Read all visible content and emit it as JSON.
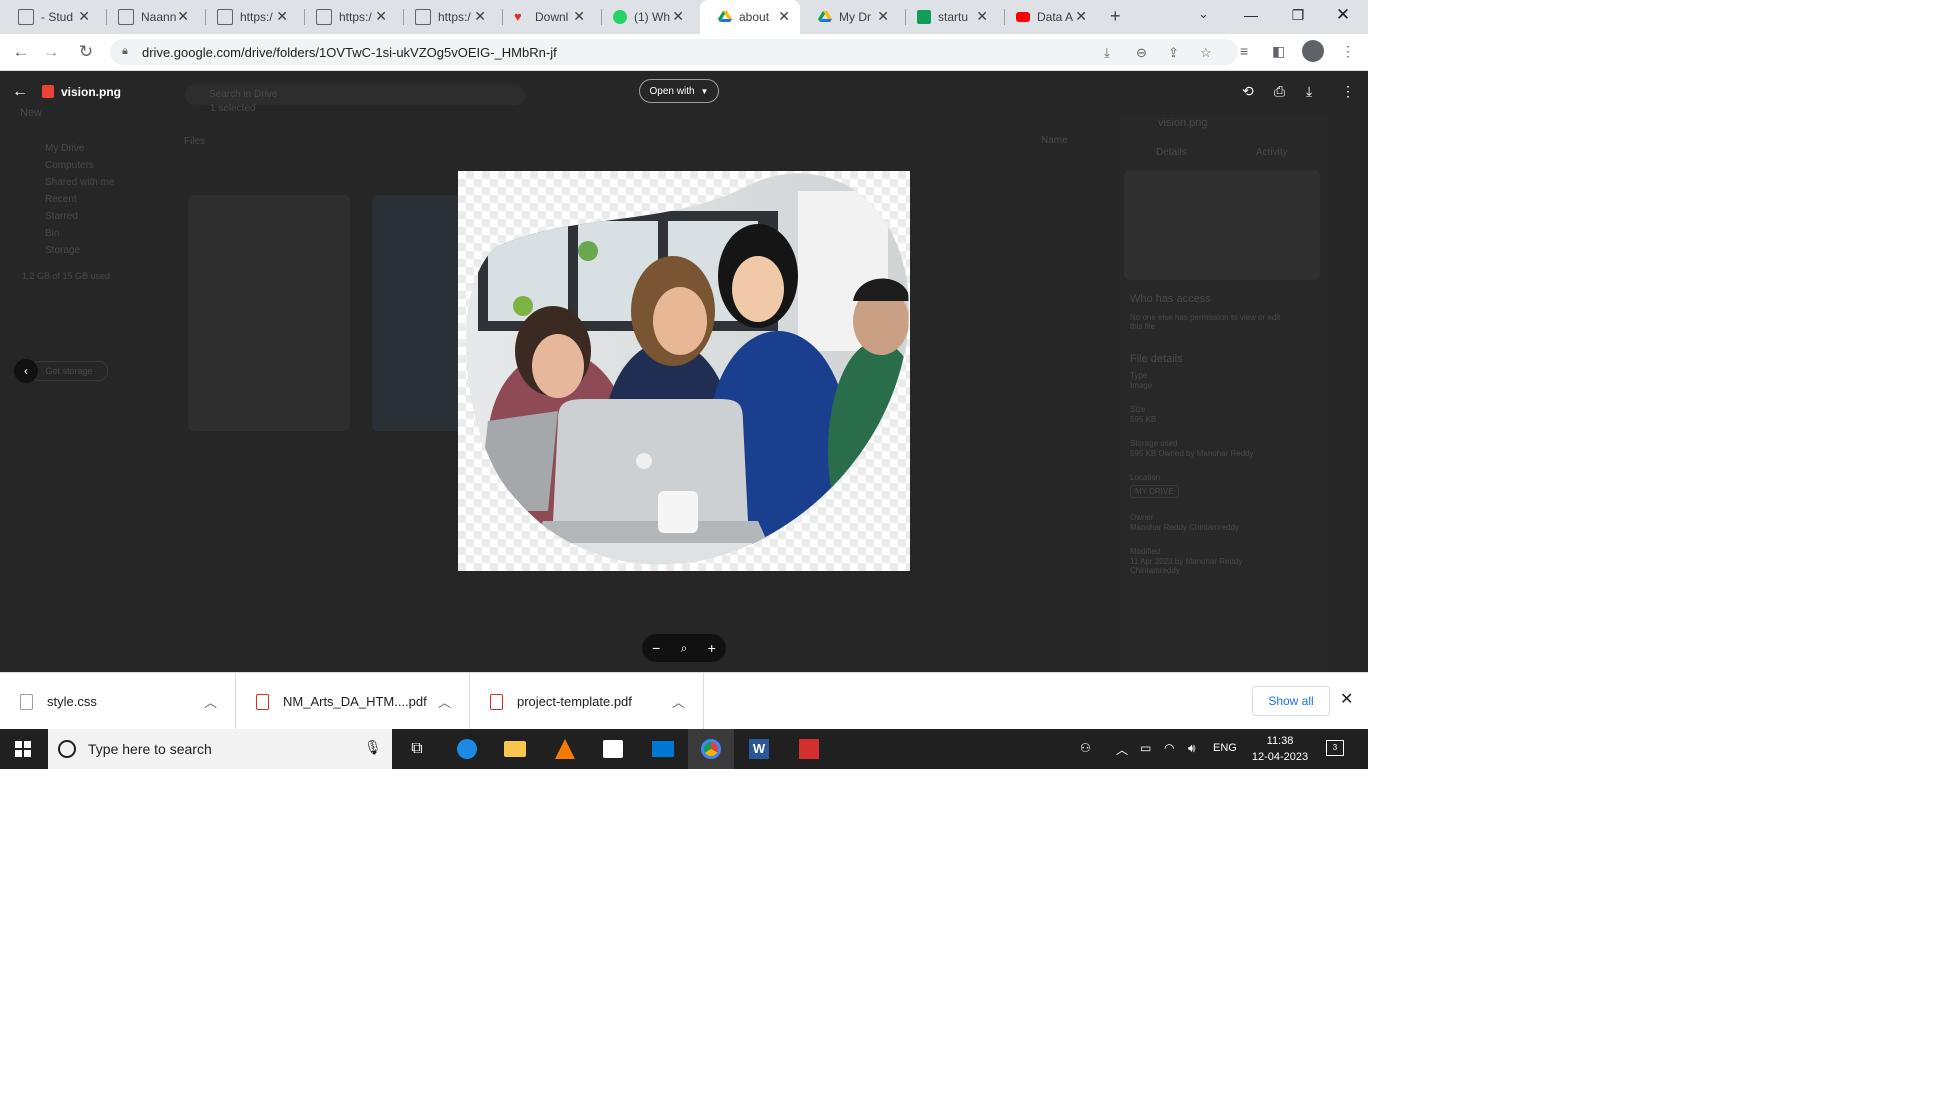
{
  "browser": {
    "tabs": [
      {
        "label": "- Stud",
        "icon": "image-doc-icon",
        "color": "#5f6368"
      },
      {
        "label": "Naann",
        "icon": "image-doc-icon",
        "color": "#5f6368"
      },
      {
        "label": "https:/",
        "icon": "image-doc-icon",
        "color": "#5f6368"
      },
      {
        "label": "https:/",
        "icon": "image-doc-icon",
        "color": "#5f6368"
      },
      {
        "label": "https:/",
        "icon": "image-doc-icon",
        "color": "#5f6368"
      },
      {
        "label": "Downl",
        "icon": "heart-icon",
        "color": "#d93025"
      },
      {
        "label": "(1) Wh",
        "icon": "whatsapp-icon",
        "color": "#25d366"
      },
      {
        "label": "about",
        "icon": "drive-icon",
        "color": "#1a73e8"
      },
      {
        "label": "My Dr",
        "icon": "drive-icon",
        "color": "#1a73e8"
      },
      {
        "label": "startu",
        "icon": "sheets-icon",
        "color": "#0f9d58"
      },
      {
        "label": "Data A",
        "icon": "youtube-icon",
        "color": "#ff0000"
      }
    ],
    "url": "drive.google.com/drive/folders/1OVTwC-1si-ukVZOg5vOEIG-_HMbRn-jf"
  },
  "viewer": {
    "file_name": "vision.png",
    "open_with_label": "Open with"
  },
  "background_ui": {
    "search_placeholder": "Search in Drive",
    "new_label": "New",
    "selected_label": "1 selected",
    "files_label": "Files",
    "nav_items": [
      "My Drive",
      "Computers",
      "Shared with me",
      "Recent",
      "Starred",
      "Bin",
      "Storage"
    ],
    "storage_text": "1.2 GB of 15 GB used",
    "get_storage_label": "Get storage",
    "details_tab": "Details",
    "activity_tab": "Activity",
    "panel_title": "vision.png",
    "who_has_access": "Who has access",
    "access_note": "No one else has permission to view or edit this file",
    "file_details": "File details",
    "details": [
      {
        "k": "Type",
        "v": "Image"
      },
      {
        "k": "Size",
        "v": "595 KB"
      },
      {
        "k": "Storage used",
        "v": "595 KB Owned by Manohar Reddy"
      },
      {
        "k": "Location",
        "v": "MY DRIVE"
      },
      {
        "k": "Owner",
        "v": "Manohar Reddy Chintamreddy"
      },
      {
        "k": "Modified",
        "v": "11 Apr 2023 by Manohar Reddy Chintamreddy"
      }
    ],
    "name_sort": "Name"
  },
  "downloads": [
    {
      "name": "style.css",
      "kind": "css"
    },
    {
      "name": "NM_Arts_DA_HTM....pdf",
      "kind": "pdf"
    },
    {
      "name": "project-template.pdf",
      "kind": "pdf"
    }
  ],
  "show_all_label": "Show all",
  "taskbar": {
    "search_placeholder": "Type here to search",
    "language": "ENG",
    "time": "11:38",
    "date": "12-04-2023",
    "notification_count": "3"
  }
}
